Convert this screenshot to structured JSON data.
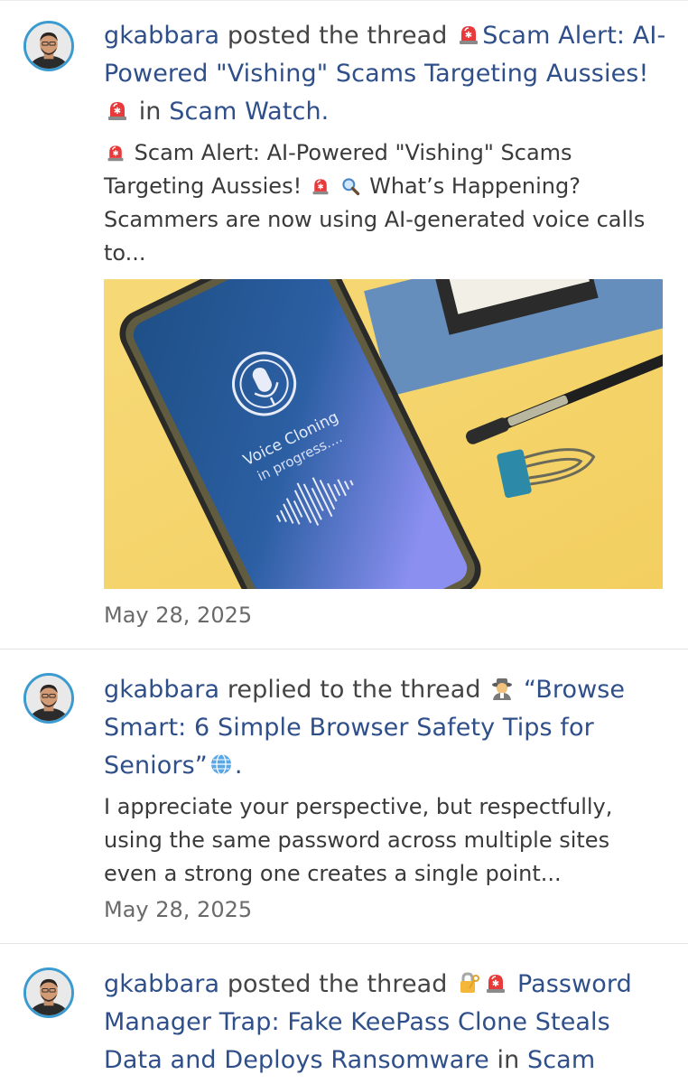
{
  "feed": {
    "items": [
      {
        "user": "gkabbara",
        "action": "posted the thread",
        "thread_title_pre_emoji": "siren",
        "thread_title": "Scam Alert: AI-Powered \"Vishing\" Scams Targeting Aussies!",
        "thread_title_post_emoji": "siren",
        "in_text": "in",
        "forum": "Scam Watch.",
        "snippet_part1": "Scam Alert: AI-Powered \"Vishing\" Scams Targeting Aussies!",
        "snippet_part2": "What’s Happening? Scammers are now using AI-generated voice calls to...",
        "image": {
          "screen_text_line1": "Voice Cloning",
          "screen_text_line2": "in progress...."
        },
        "date": "May 28, 2025"
      },
      {
        "user": "gkabbara",
        "action": "replied to the thread",
        "thread_title": "“Browse Smart: 6 Simple Browser Safety Tips for Seniors”",
        "snippet": "I appreciate your perspective, but respectfully, using the same password across multiple sites even a strong one creates a single point...",
        "date": "May 28, 2025"
      },
      {
        "user": "gkabbara",
        "action": "posted the thread",
        "thread_title": "Password Manager Trap: Fake KeePass Clone Steals Data and Deploys Ransomware",
        "in_text": "in",
        "forum": "Scam"
      }
    ]
  },
  "icons": {
    "siren": "siren-emoji",
    "magnifier": "magnifier-emoji",
    "detective": "detective-emoji",
    "globe": "globe-emoji",
    "lock": "locked-with-key-emoji"
  },
  "colors": {
    "link": "#2f4f8a",
    "text": "#444444",
    "date": "#6a6a6a",
    "avatar_ring": "#3b9bd0",
    "divider": "#e3e3e3"
  }
}
